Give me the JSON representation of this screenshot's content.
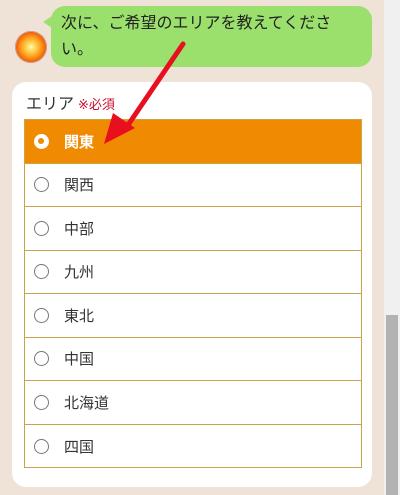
{
  "chat": {
    "message": "次に、ご希望のエリアを教えてください。"
  },
  "form": {
    "label": "エリア",
    "required": "※必須",
    "selected_index": 0,
    "options": [
      "関東",
      "関西",
      "中部",
      "九州",
      "東北",
      "中国",
      "北海道",
      "四国"
    ]
  },
  "colors": {
    "accent": "#f08a00",
    "bubble": "#9be06d",
    "arrow": "#e8101e",
    "background": "#efe3d8",
    "option_border": "#c9a44b"
  },
  "icons": {
    "avatar": "sun-avatar-icon",
    "annotation": "red-arrow-icon"
  }
}
